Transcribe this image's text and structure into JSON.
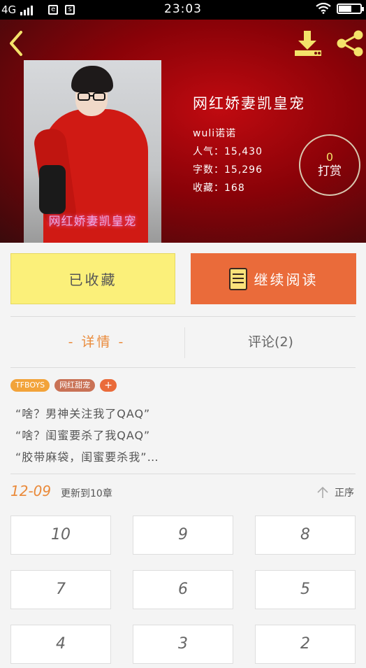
{
  "status_bar": {
    "network": "4G",
    "time": "23:03"
  },
  "book": {
    "title": "网红娇妻凯皇宠",
    "author": "wuli诺诺",
    "popularity_label": "人气：",
    "popularity": "15,430",
    "words_label": "字数：",
    "words": "15,296",
    "favorites_label": "收藏：",
    "favorites": "168",
    "cover_caption": "网红娇妻凯皇宠"
  },
  "tip": {
    "count": "0",
    "label": "打赏"
  },
  "actions": {
    "favorited_label": "已收藏",
    "continue_label": "继续阅读"
  },
  "tabs": {
    "details": "- 详情 -",
    "comments": "评论(2)"
  },
  "tags": [
    "TFBOYS",
    "网红甜宠",
    "+"
  ],
  "description": [
    "“啥？男神关注我了QAQ”",
    "“啥？闺蜜要杀了我QAQ”",
    "“胶带麻袋，闺蜜要杀我”…"
  ],
  "update": {
    "date": "12-09",
    "text": "更新到10章",
    "sort_label": "正序"
  },
  "chapters": [
    "10",
    "9",
    "8",
    "7",
    "6",
    "5",
    "4",
    "3",
    "2"
  ],
  "colors": {
    "accent_orange": "#ea6b3a",
    "fav_yellow": "#fbf07a",
    "icon_yellow": "#f4e26a"
  },
  "icons": {
    "back": "chevron-left-icon",
    "download": "download-icon",
    "share": "share-icon",
    "book": "book-icon",
    "sort": "arrow-up-icon"
  }
}
